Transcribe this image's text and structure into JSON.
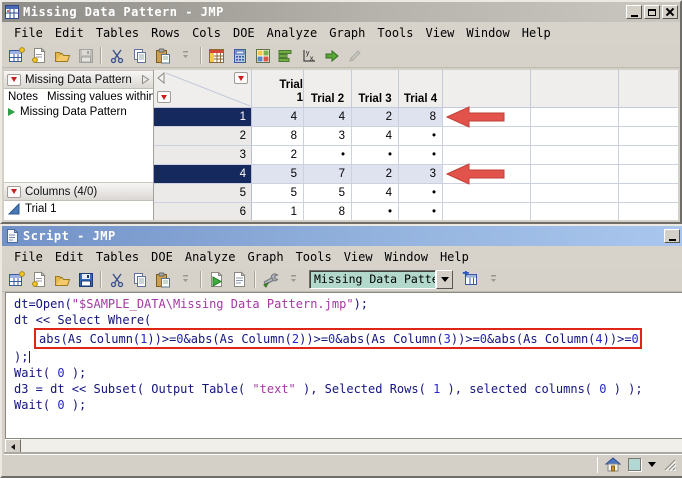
{
  "window1": {
    "title": "Missing Data Pattern - JMP",
    "menu": [
      "File",
      "Edit",
      "Tables",
      "Rows",
      "Cols",
      "DOE",
      "Analyze",
      "Graph",
      "Tools",
      "View",
      "Window",
      "Help"
    ],
    "side_panel": {
      "table_panel_title": "Missing Data Pattern",
      "notes_label": "Notes",
      "notes_value": "Missing values within",
      "table_script_item": "Missing Data Pattern",
      "columns_panel_title": "Columns (4/0)",
      "columns": [
        {
          "label": "Trial 1",
          "type": "continuous"
        }
      ]
    },
    "grid": {
      "columns": [
        "Trial 1",
        "Trial 2",
        "Trial 3",
        "Trial 4"
      ],
      "missing_marker": "•",
      "rows": [
        {
          "n": "1",
          "selected": true,
          "arrow": true,
          "values": [
            "4",
            "4",
            "2",
            "8"
          ]
        },
        {
          "n": "2",
          "selected": false,
          "arrow": false,
          "values": [
            "8",
            "3",
            "4",
            "•"
          ]
        },
        {
          "n": "3",
          "selected": false,
          "arrow": false,
          "values": [
            "2",
            "•",
            "•",
            "•"
          ]
        },
        {
          "n": "4",
          "selected": true,
          "arrow": true,
          "values": [
            "5",
            "7",
            "2",
            "3"
          ]
        },
        {
          "n": "5",
          "selected": false,
          "arrow": false,
          "values": [
            "5",
            "5",
            "4",
            "•"
          ]
        },
        {
          "n": "6",
          "selected": false,
          "arrow": false,
          "values": [
            "1",
            "8",
            "•",
            "•"
          ]
        }
      ]
    }
  },
  "window2": {
    "title": "Script - JMP",
    "menu": [
      "File",
      "Edit",
      "Tables",
      "DOE",
      "Analyze",
      "Graph",
      "Tools",
      "View",
      "Window",
      "Help"
    ],
    "toolbar": {
      "table_combo_value": "Missing Data Pattern"
    },
    "script_lines": [
      {
        "segments": [
          {
            "t": "dt=Open(",
            "c": "d"
          },
          {
            "t": "\"$SAMPLE_DATA\\Missing Data Pattern.jmp\"",
            "c": "s"
          },
          {
            "t": ");",
            "c": "d"
          }
        ]
      },
      {
        "segments": [
          {
            "t": "dt << Select Where(",
            "c": "d"
          }
        ]
      },
      {
        "boxed": true,
        "segments": [
          {
            "t": "abs(As Column(",
            "c": "d"
          },
          {
            "t": "1",
            "c": "n"
          },
          {
            "t": "))>=",
            "c": "d"
          },
          {
            "t": "0",
            "c": "n"
          },
          {
            "t": "&abs(As Column(",
            "c": "d"
          },
          {
            "t": "2",
            "c": "n"
          },
          {
            "t": "))>=",
            "c": "d"
          },
          {
            "t": "0",
            "c": "n"
          },
          {
            "t": "&abs(As Column(",
            "c": "d"
          },
          {
            "t": "3",
            "c": "n"
          },
          {
            "t": "))>=",
            "c": "d"
          },
          {
            "t": "0",
            "c": "n"
          },
          {
            "t": "&abs(As Column(",
            "c": "d"
          },
          {
            "t": "4",
            "c": "n"
          },
          {
            "t": "))>=",
            "c": "d"
          },
          {
            "t": "0",
            "c": "n"
          }
        ]
      },
      {
        "caret": true,
        "segments": [
          {
            "t": ");",
            "c": "d"
          }
        ]
      },
      {
        "segments": [
          {
            "t": "Wait( ",
            "c": "d"
          },
          {
            "t": "0",
            "c": "n"
          },
          {
            "t": " );",
            "c": "d"
          }
        ]
      },
      {
        "segments": [
          {
            "t": "d3 = dt << Subset( Output Table( ",
            "c": "d"
          },
          {
            "t": "\"text\"",
            "c": "s"
          },
          {
            "t": " ), Selected Rows( ",
            "c": "d"
          },
          {
            "t": "1",
            "c": "n"
          },
          {
            "t": " ), selected columns( ",
            "c": "d"
          },
          {
            "t": "0",
            "c": "n"
          },
          {
            "t": " ) );",
            "c": "d"
          }
        ]
      },
      {
        "segments": [
          {
            "t": "Wait( ",
            "c": "d"
          },
          {
            "t": "0",
            "c": "n"
          },
          {
            "t": " );",
            "c": "d"
          }
        ]
      }
    ]
  },
  "colors": {
    "selected_row_bg": "#dfe2ef",
    "selected_row_label_bg": "#16295e",
    "arrow_red": "#e2544b",
    "highlight_box_red": "#de2517",
    "code_default": "#14147e",
    "code_string": "#a438a4",
    "code_number": "#2626cc",
    "combo_bg": "#b2d9cc",
    "active_title_start": "#7292c8",
    "active_title_end": "#a9c7ee",
    "inactive_title_start": "#8e8c87",
    "inactive_title_end": "#cac7c0"
  }
}
